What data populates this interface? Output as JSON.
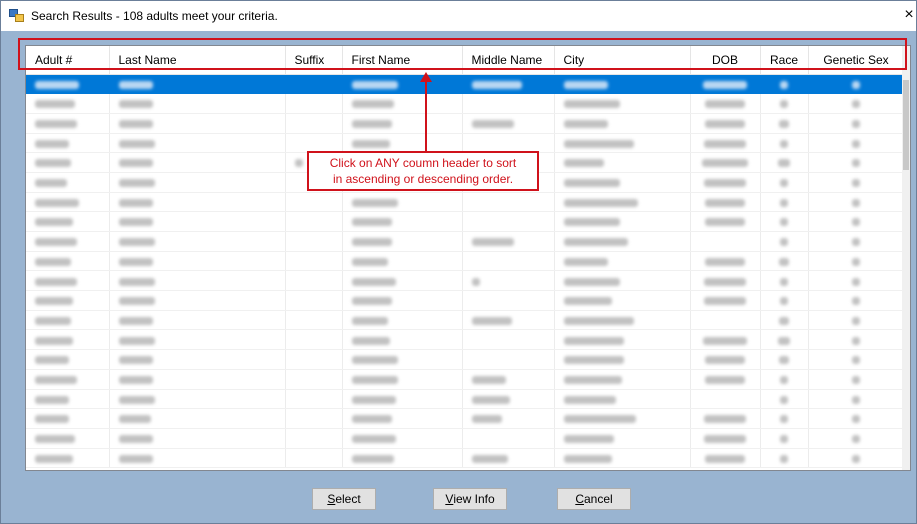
{
  "window": {
    "title": "Search Results - 108 adults meet your criteria.",
    "close_glyph": "×"
  },
  "grid": {
    "columns": [
      "Adult #",
      "Last Name",
      "Suffix",
      "First Name",
      "Middle Name",
      "City",
      "DOB",
      "Race",
      "Genetic Sex"
    ],
    "selected_row_index": 0
  },
  "annotation": {
    "callout_line1": "Click on ANY coumn header to sort",
    "callout_line2": "in ascending or descending order."
  },
  "buttons": {
    "select_prefix": "",
    "select_accel": "S",
    "select_rest": "elect",
    "view_prefix": "",
    "view_accel": "V",
    "view_rest": "iew Info",
    "cancel_prefix": "",
    "cancel_accel": "C",
    "cancel_rest": "ancel"
  },
  "colors": {
    "selection": "#0078d7",
    "annotation": "#d0121b",
    "window_bg": "#99b4d1"
  }
}
